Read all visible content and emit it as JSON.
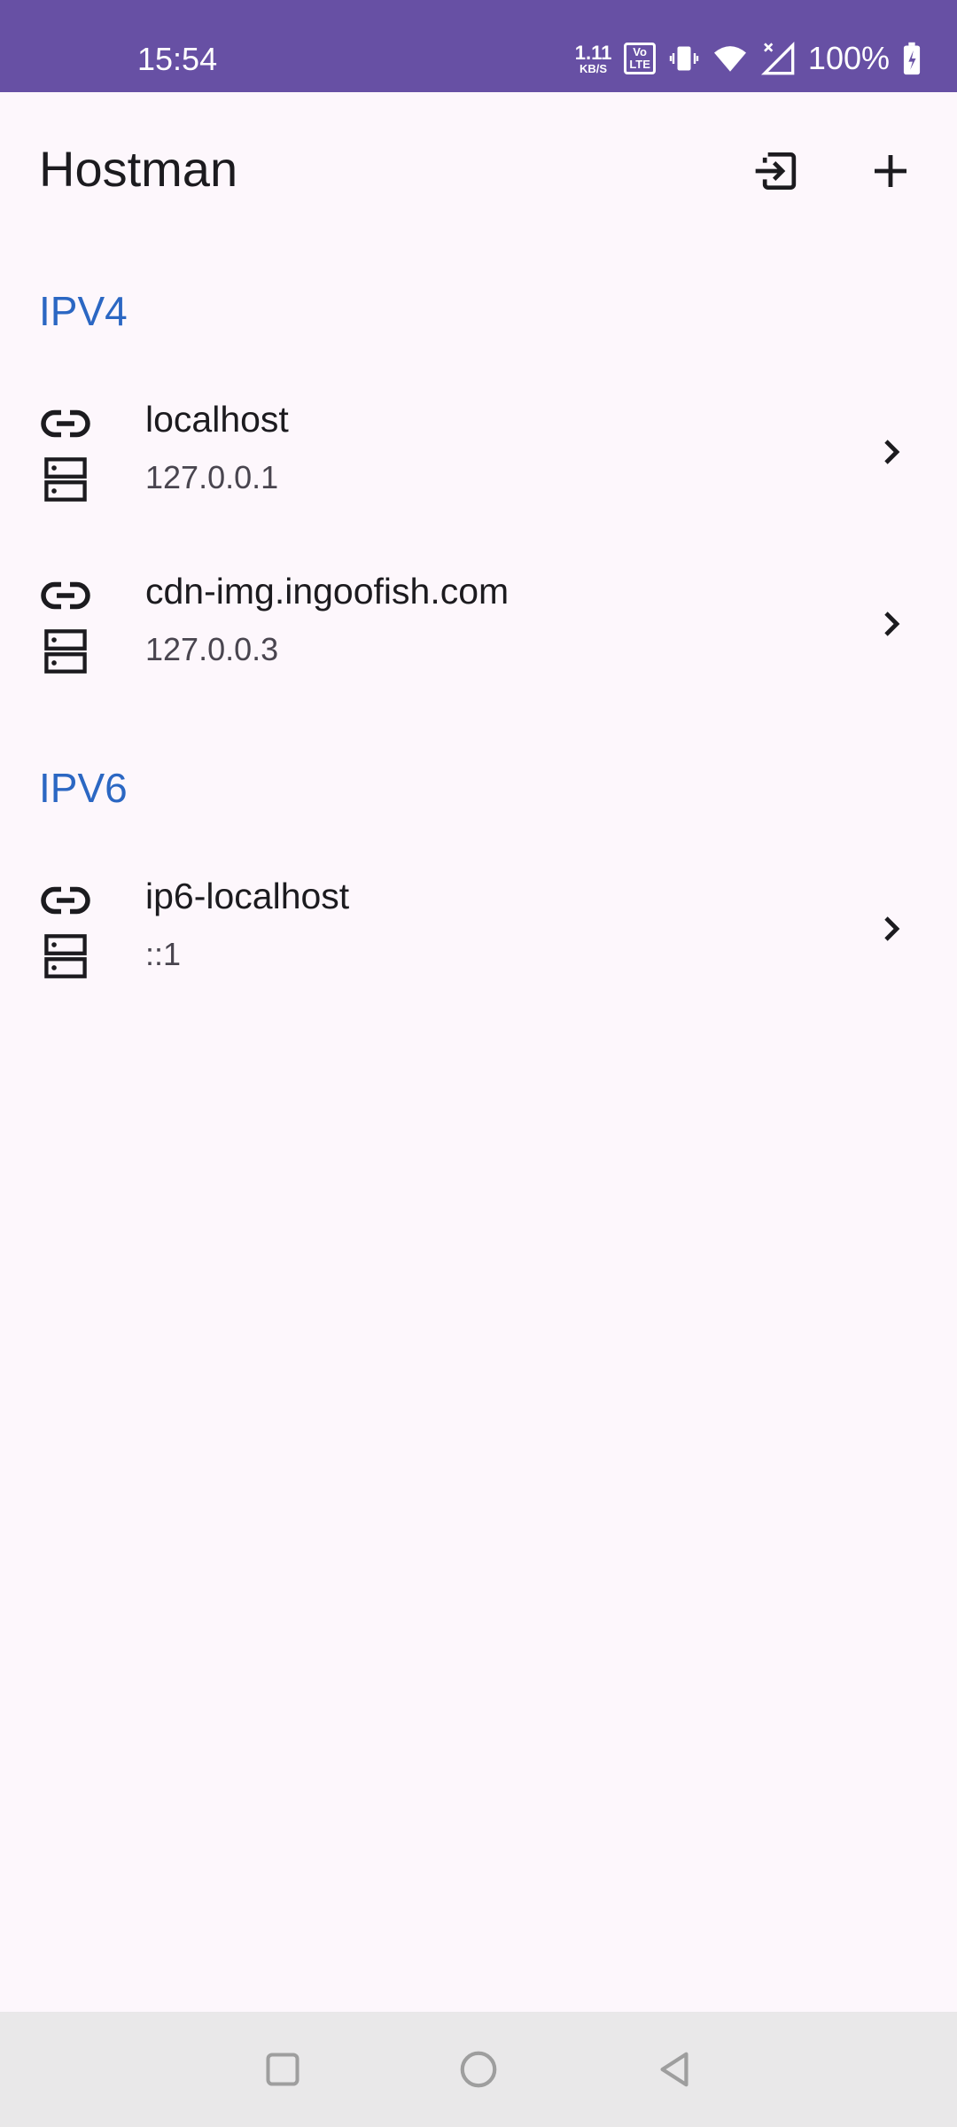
{
  "status_bar": {
    "time": "15:54",
    "net_rate_value": "1.11",
    "net_rate_unit": "KB/S",
    "volte_top": "Vo",
    "volte_bottom": "LTE",
    "battery_percent": "100%"
  },
  "app_bar": {
    "title": "Hostman",
    "actions": [
      "import-icon",
      "add-icon"
    ]
  },
  "sections": [
    {
      "header": "IPV4",
      "entries": [
        {
          "hostname": "localhost",
          "address": "127.0.0.1"
        },
        {
          "hostname": "cdn-img.ingoofish.com",
          "address": "127.0.0.3"
        }
      ]
    },
    {
      "header": "IPV6",
      "entries": [
        {
          "hostname": "ip6-localhost",
          "address": "::1"
        }
      ]
    }
  ],
  "nav_bar": {
    "buttons": [
      "recents-square-icon",
      "home-circle-icon",
      "back-triangle-icon"
    ]
  },
  "colors": {
    "status_bar": "#6750A4",
    "background": "#FDF7FC",
    "section_header": "#2B67C3",
    "nav_bar": "#E9E8E9"
  }
}
